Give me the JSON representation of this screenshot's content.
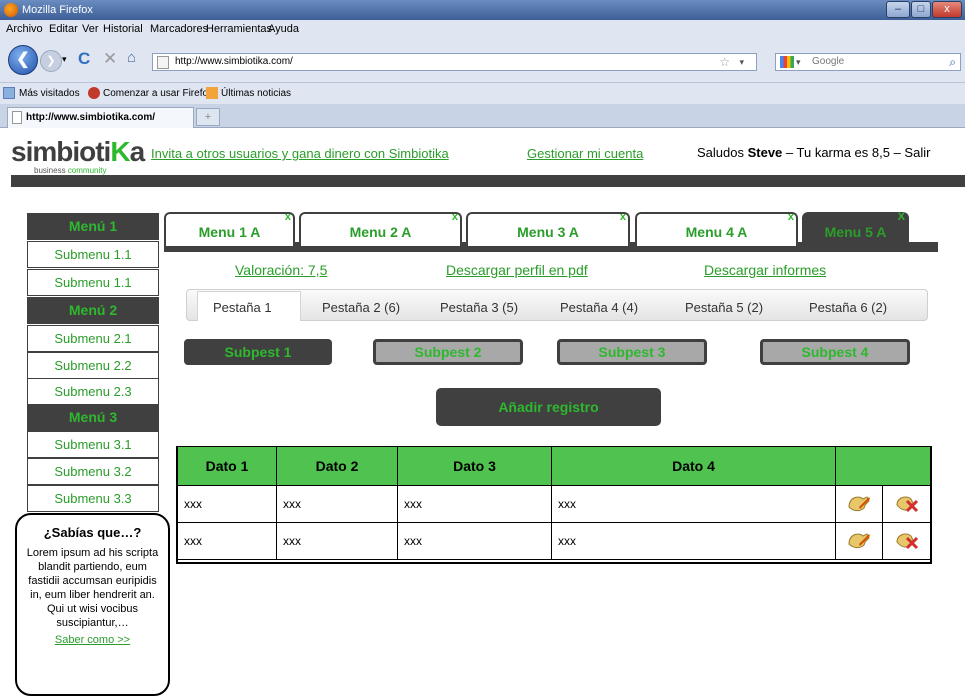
{
  "browser": {
    "window_title": "Mozilla Firefox",
    "menu": [
      "Archivo",
      "Editar",
      "Ver",
      "Historial",
      "Marcadores",
      "Herramientas",
      "Ayuda"
    ],
    "url": "http://www.simbiotika.com/",
    "search_placeholder": "Google",
    "bookmarks": [
      "Más visitados",
      "Comenzar a usar Firefox",
      "Últimas noticias"
    ],
    "tab_title": "http://www.simbiotika.com/",
    "new_tab": "+"
  },
  "header": {
    "logo_main": "simbioti",
    "logo_k": "K",
    "logo_end": "a",
    "logo_sub_1": "business ",
    "logo_sub_2": "community",
    "invite_link": "Invita a otros usuarios y gana dinero con Simbiotika",
    "account_link": "Gestionar mi cuenta",
    "greeting_prefix": "Saludos ",
    "user": "Steve",
    "karma_text": " – Tu karma es 8,5 – Salir"
  },
  "sidebar": {
    "items": [
      {
        "label": "Menú 1",
        "type": "head"
      },
      {
        "label": "Submenu 1.1",
        "type": "sub"
      },
      {
        "label": "Submenu 1.1",
        "type": "sub"
      },
      {
        "label": "Menú 2",
        "type": "head"
      },
      {
        "label": "Submenu 2.1",
        "type": "sub"
      },
      {
        "label": "Submenu 2.2",
        "type": "sub"
      },
      {
        "label": "Submenu 2.3",
        "type": "sub"
      },
      {
        "label": "Menú 3",
        "type": "head"
      },
      {
        "label": "Submenu 3.1",
        "type": "sub"
      },
      {
        "label": "Submenu 3.2",
        "type": "sub"
      },
      {
        "label": "Submenu 3.3",
        "type": "sub"
      }
    ]
  },
  "tip": {
    "title": "¿Sabías que…?",
    "text": "Lorem ipsum ad his scripta blandit partiendo, eum fastidii accumsan euripidis in, eum liber hendrerit an. Qui ut wisi vocibus suscipiantur,…",
    "link": "Saber como >>"
  },
  "menu_tabs": [
    {
      "label": "Menu 1 A",
      "close": "x",
      "active": false
    },
    {
      "label": "Menu 2 A",
      "close": "x",
      "active": false
    },
    {
      "label": "Menu 3 A",
      "close": "x",
      "active": false
    },
    {
      "label": "Menu 4 A",
      "close": "x",
      "active": false
    },
    {
      "label": "Menu 5 A",
      "close": "X",
      "active": true
    }
  ],
  "links": {
    "valoracion": "Valoración: 7,5",
    "pdf": "Descargar perfil en pdf",
    "informes": "Descargar informes"
  },
  "pestanas": [
    "Pestaña 1",
    "Pestaña 2 (6)",
    "Pestaña 3  (5)",
    "Pestaña 4  (4)",
    "Pestaña 5 (2)",
    "Pestaña 6  (2)"
  ],
  "subpest": [
    "Subpest 1",
    "Subpest  2",
    "Subpest  3",
    "Subpest 4"
  ],
  "add_button": "Añadir registro",
  "table": {
    "headers": [
      "Dato 1",
      "Dato 2",
      "Dato 3",
      "Dato 4"
    ],
    "rows": [
      [
        "xxx",
        "xxx",
        "xxx",
        "xxx"
      ],
      [
        "xxx",
        "xxx",
        "xxx",
        "xxx"
      ]
    ]
  },
  "colors": {
    "brand_green": "#2eb82e",
    "dark": "#404040",
    "header_green": "#4fc24f"
  }
}
